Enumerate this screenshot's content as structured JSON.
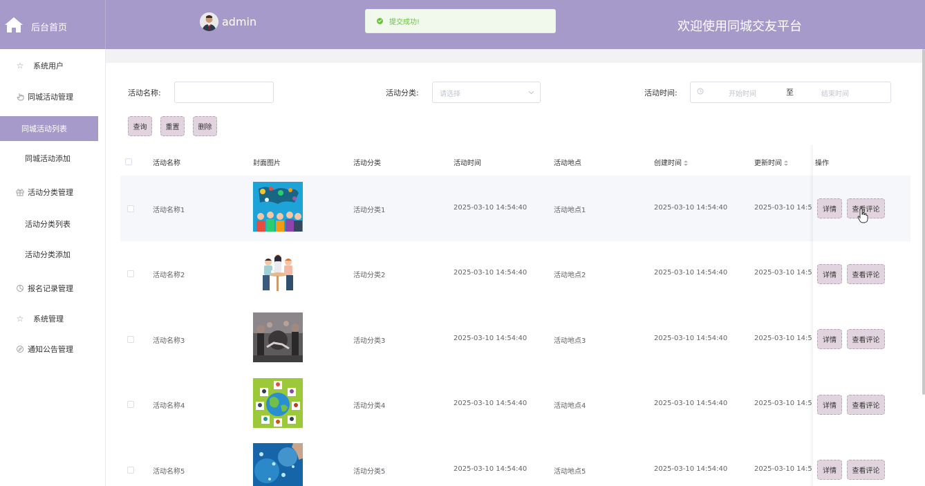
{
  "header": {
    "home_label": "后台首页",
    "username": "admin",
    "welcome": "欢迎使用同城交友平台"
  },
  "toast": {
    "message": "提交成功!",
    "color": "#67c23a"
  },
  "sidebar": {
    "items": [
      {
        "label": "系统用户",
        "icon": "star-icon"
      },
      {
        "label": "同城活动管理",
        "icon": "hand-icon"
      },
      {
        "label": "同城活动列表",
        "active": true
      },
      {
        "label": "同城活动添加"
      },
      {
        "label": "活动分类管理",
        "icon": "gift-icon"
      },
      {
        "label": "活动分类列表"
      },
      {
        "label": "活动分类添加"
      },
      {
        "label": "报名记录管理",
        "icon": "pie-icon"
      },
      {
        "label": "系统管理",
        "icon": "star-icon"
      },
      {
        "label": "通知公告管理",
        "icon": "compass-icon"
      }
    ]
  },
  "search": {
    "name_label": "活动名称:",
    "name_value": "",
    "category_label": "活动分类:",
    "category_placeholder": "请选择",
    "time_label": "活动时间:",
    "start_placeholder": "开始时间",
    "range_separator": "至",
    "end_placeholder": "结束时间"
  },
  "toolbar": {
    "query_label": "查询",
    "reset_label": "重置",
    "delete_label": "删除"
  },
  "table": {
    "columns": [
      "活动名称",
      "封面图片",
      "活动分类",
      "活动时间",
      "活动地点",
      "创建时间",
      "更新时间",
      "操作"
    ],
    "rows": [
      {
        "name": "活动名称1",
        "category": "活动分类1",
        "time": "2025-03-10 14:54:40",
        "location": "活动地点1",
        "created": "2025-03-10 14:54:40",
        "updated": "2025-03-10 14:5"
      },
      {
        "name": "活动名称2",
        "category": "活动分类2",
        "time": "2025-03-10 14:54:40",
        "location": "活动地点2",
        "created": "2025-03-10 14:54:40",
        "updated": "2025-03-10 14:5"
      },
      {
        "name": "活动名称3",
        "category": "活动分类3",
        "time": "2025-03-10 14:54:40",
        "location": "活动地点3",
        "created": "2025-03-10 14:54:40",
        "updated": "2025-03-10 14:5"
      },
      {
        "name": "活动名称4",
        "category": "活动分类4",
        "time": "2025-03-10 14:54:40",
        "location": "活动地点4",
        "created": "2025-03-10 14:54:40",
        "updated": "2025-03-10 14:5"
      },
      {
        "name": "活动名称5",
        "category": "活动分类5",
        "time": "2025-03-10 14:54:40",
        "location": "活动地点5",
        "created": "2025-03-10 14:54:40",
        "updated": "2025-03-10 14:5"
      }
    ],
    "detail_label": "详情",
    "comments_label": "查看评论"
  },
  "colors": {
    "primary": "#a59ac9",
    "button": "#e2d4de"
  }
}
